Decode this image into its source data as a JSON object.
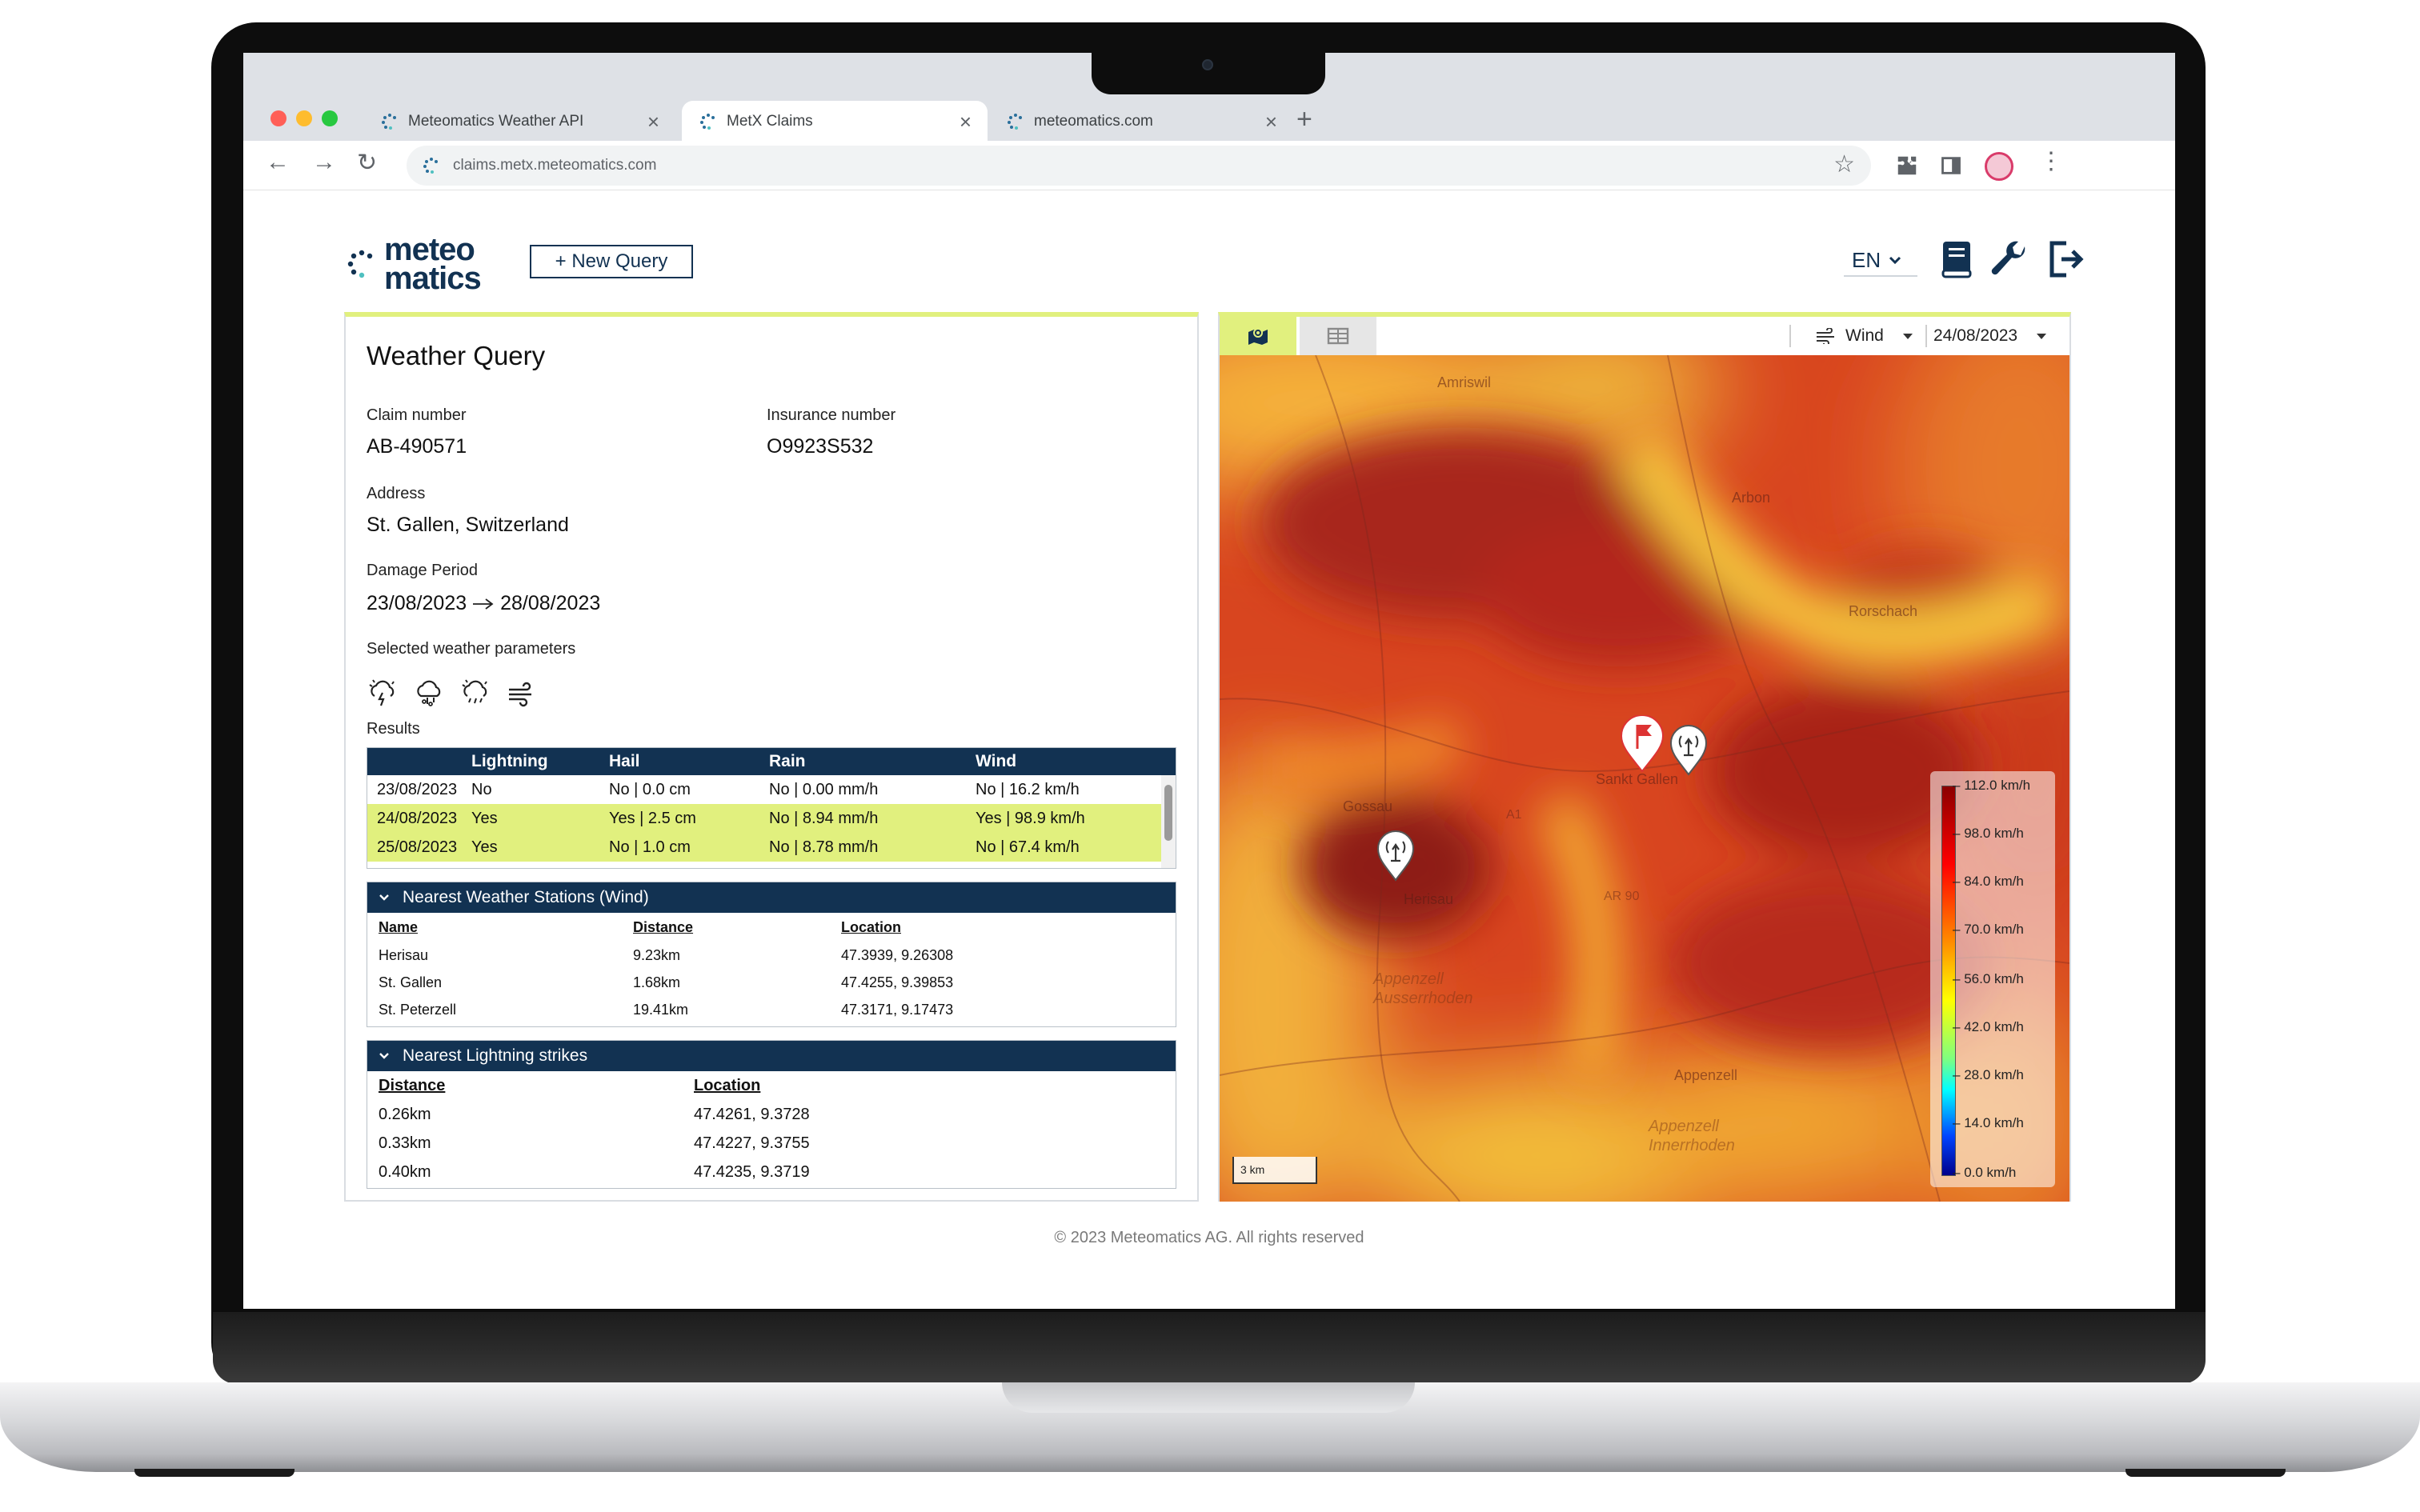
{
  "browser": {
    "tabs": [
      {
        "label": "Meteomatics Weather API",
        "active": false
      },
      {
        "label": "MetX Claims",
        "active": true
      },
      {
        "label": "meteomatics.com",
        "active": false
      }
    ],
    "url": "claims.metx.meteomatics.com"
  },
  "app": {
    "logo_line1": "meteo",
    "logo_line2": "matics",
    "new_query_label": "+ New Query",
    "language": "EN",
    "brand_color": "#123252",
    "accent_color": "#e1f07e"
  },
  "query": {
    "title": "Weather Query",
    "claim_label": "Claim number",
    "claim_value": "AB-490571",
    "insurance_label": "Insurance number",
    "insurance_value": "O9923S532",
    "address_label": "Address",
    "address_value": "St. Gallen, Switzerland",
    "period_label": "Damage Period",
    "period_start": "23/08/2023",
    "period_end": "28/08/2023",
    "params_label": "Selected weather parameters",
    "params_icons": [
      "lightning-cloud-icon",
      "hail-cloud-icon",
      "rain-cloud-icon",
      "wind-icon"
    ],
    "results_label": "Results"
  },
  "results": {
    "headers": [
      "",
      "Lightning",
      "Hail",
      "Rain",
      "Wind"
    ],
    "rows": [
      {
        "date": "23/08/2023",
        "lightning": "No",
        "hail": "No | 0.0 cm",
        "rain": "No | 0.00 mm/h",
        "wind": "No | 16.2 km/h",
        "highlight": false
      },
      {
        "date": "24/08/2023",
        "lightning": "Yes",
        "hail": "Yes | 2.5 cm",
        "rain": "No | 8.94 mm/h",
        "wind": "Yes | 98.9 km/h",
        "highlight": true
      },
      {
        "date": "25/08/2023",
        "lightning": "Yes",
        "hail": "No | 1.0 cm",
        "rain": "No | 8.78 mm/h",
        "wind": "No | 67.4 km/h",
        "highlight": true
      }
    ]
  },
  "stations": {
    "title": "Nearest Weather Stations (Wind)",
    "headers": [
      "Name",
      "Distance",
      "Location"
    ],
    "rows": [
      {
        "name": "Herisau",
        "distance": "9.23km",
        "location": "47.3939, 9.26308"
      },
      {
        "name": "St. Gallen",
        "distance": "1.68km",
        "location": "47.4255, 9.39853"
      },
      {
        "name": "St. Peterzell",
        "distance": "19.41km",
        "location": "47.3171, 9.17473"
      }
    ]
  },
  "lightning": {
    "title": "Nearest Lightning strikes",
    "headers": [
      "Distance",
      "Location"
    ],
    "rows": [
      {
        "distance": "0.26km",
        "location": "47.4261, 9.3728"
      },
      {
        "distance": "0.33km",
        "location": "47.4227, 9.3755"
      },
      {
        "distance": "0.40km",
        "location": "47.4235, 9.3719"
      }
    ]
  },
  "map": {
    "parameter": "Wind",
    "date": "24/08/2023",
    "scale": "3 km",
    "places": [
      "Amriswil",
      "Arbon",
      "Rorschach",
      "Gossau",
      "Sankt Gallen",
      "Herisau",
      "Appenzell Ausserrhoden",
      "Appenzell",
      "Appenzell Innerrhoden",
      "AR 90",
      "A1"
    ],
    "legend": [
      "112.0 km/h",
      "98.0 km/h",
      "84.0 km/h",
      "70.0 km/h",
      "56.0 km/h",
      "42.0 km/h",
      "28.0 km/h",
      "14.0 km/h",
      "0.0 km/h"
    ]
  },
  "footer": "© 2023 Meteomatics AG. All rights reserved"
}
